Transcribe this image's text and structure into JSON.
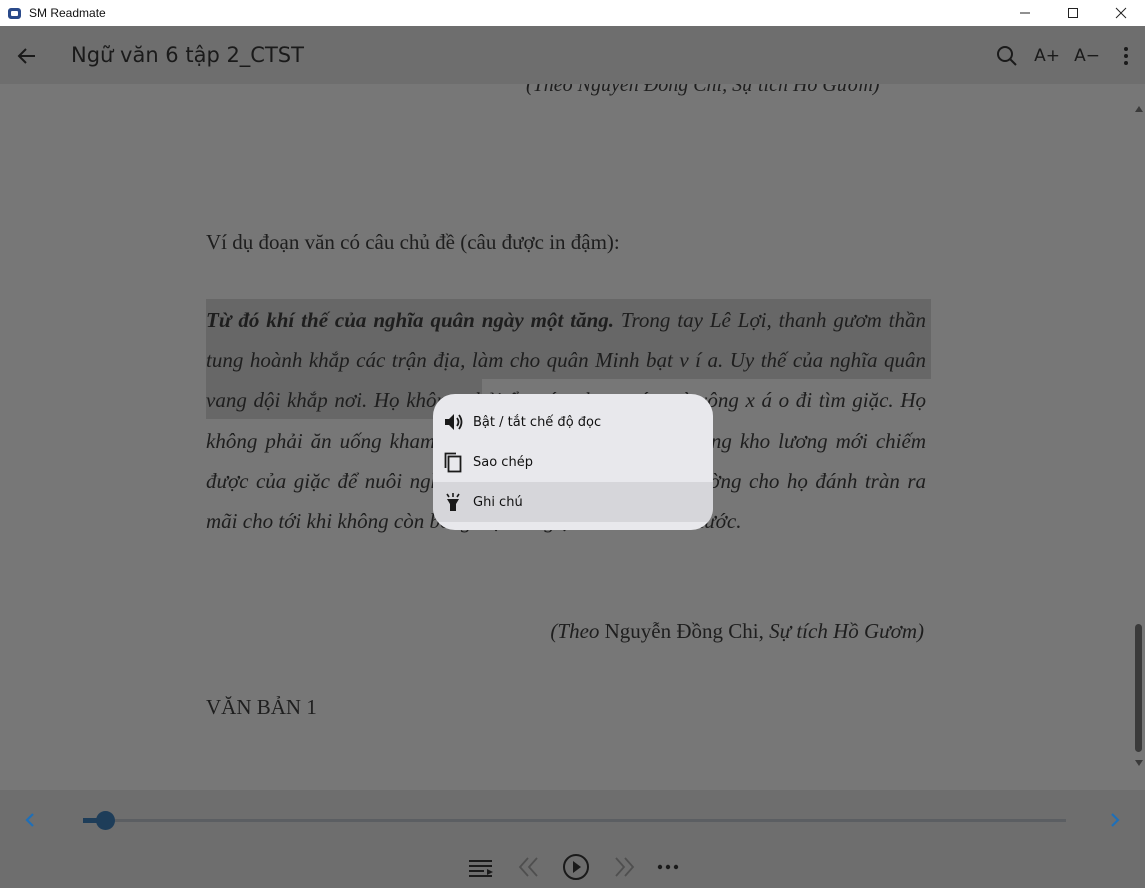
{
  "window": {
    "title": "SM Readmate"
  },
  "appbar": {
    "title": "Ngữ văn 6 tập 2_CTST",
    "font_increase": "A+",
    "font_decrease": "A−"
  },
  "content": {
    "cutoff_source": "(Theo Nguyễn Đồng Chi, Sự tích Hồ Gươm)",
    "example_heading": "Ví dụ đoạn văn có câu chủ đề (câu được in đậm):",
    "topic_sentence": "Từ đó khí thế của nghĩa quân ngày một tăng.",
    "paragraph_rest": " Trong tay Lê Lợi, thanh gươm thần tung hoành khắp các trận địa, làm cho quân Minh bạt v í a. Uy thế của nghĩa quân vang dội khắp nơi. Họ không phải ẩn náu như trước mà xông x á o đi tìm giặc. Họ không phải ăn uống kham khổ như trước nữa, đã có những kho lương mới chiếm được của giặc để nuôi nghĩa quân. Gươm thần đã mở đường cho họ đánh tràn ra mãi cho tới khi không còn bóng một tên giặc nào trên đất nước.",
    "source_theo": "(Theo",
    "source_author": " Nguyễn Đồng Chi, ",
    "source_title": "Sự tích Hồ Gươm)",
    "section_heading": "VĂN BẢN 1"
  },
  "context_menu": {
    "items": [
      {
        "label": "Bật / tắt chế độ đọc",
        "icon": "speaker-icon"
      },
      {
        "label": "Sao chép",
        "icon": "copy-icon"
      },
      {
        "label": "Ghi chú",
        "icon": "highlighter-icon"
      }
    ],
    "active_index": 2
  },
  "reader": {
    "progress_fraction": 0.022
  },
  "colors": {
    "accent": "#1e3d59",
    "nav_arrow": "#1f6fb8",
    "overlay_bg": "#777777"
  }
}
